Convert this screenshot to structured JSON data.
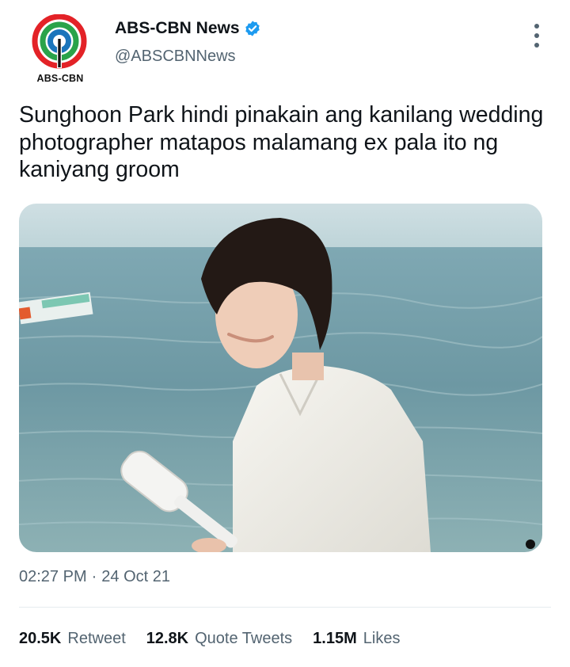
{
  "account": {
    "display_name": "ABS-CBN News",
    "handle": "@ABSCBNNews",
    "logo_text": "ABS-CBN",
    "verified": true
  },
  "tweet": {
    "text": "Sunghoon Park hindi pinakain ang kanilang wedding photographer matapos malamang ex pala ito ng kaniyang groom",
    "time": "02:27 PM",
    "separator": "·",
    "date": "24 Oct 21"
  },
  "stats": {
    "retweets": {
      "count": "20.5K",
      "label": "Retweet"
    },
    "quotes": {
      "count": "12.8K",
      "label": "Quote Tweets"
    },
    "likes": {
      "count": "1.15M",
      "label": "Likes"
    }
  },
  "colors": {
    "text_primary": "#0f1419",
    "text_secondary": "#536471",
    "verified_blue": "#1d9bf0",
    "logo_red": "#e32227",
    "logo_green": "#2aa34a",
    "logo_blue": "#1b75bb"
  },
  "icons": [
    "verified-badge-icon",
    "more-options-icon"
  ]
}
